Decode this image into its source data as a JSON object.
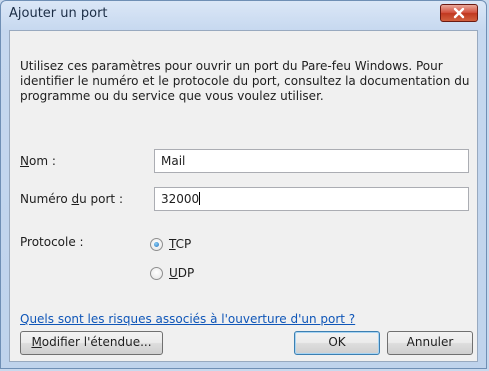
{
  "window": {
    "title": "Ajouter un port"
  },
  "description": "Utilisez ces paramètres pour ouvrir un port du Pare-feu Windows. Pour identifier le numéro et le protocole du port, consultez la documentation du programme ou du service que vous voulez utiliser.",
  "form": {
    "name_label_acc": "N",
    "name_label_rest": "om :",
    "name_value": "Mail",
    "port_label_pre": "Numéro ",
    "port_label_acc": "d",
    "port_label_rest": "u port :",
    "port_value": "32000",
    "protocol_label": "Protocole :",
    "protocol_options": [
      {
        "acc": "T",
        "rest": "CP",
        "checked": true
      },
      {
        "acc": "U",
        "rest": "DP",
        "checked": false
      }
    ]
  },
  "link_text": "Quels sont les risques associés à l'ouverture d'un port ?",
  "buttons": {
    "scope_acc": "M",
    "scope_rest": "odifier l'étendue...",
    "ok": "OK",
    "cancel": "Annuler"
  },
  "icons": {
    "close": "close-icon",
    "radio": "radio-button"
  },
  "colors": {
    "link": "#0f56b8",
    "close_button": "#c0381f",
    "titlebar": "#c6d8ef"
  }
}
